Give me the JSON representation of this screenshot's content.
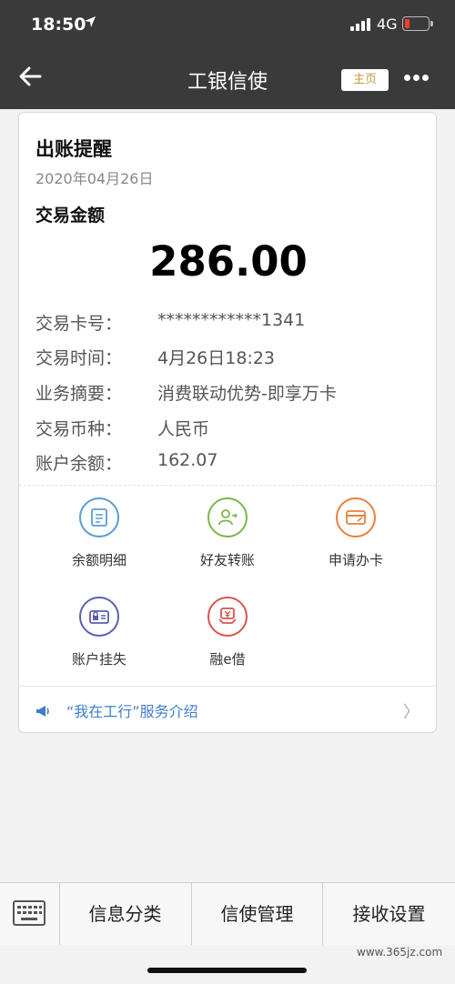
{
  "status_bar": {
    "time": "18:50",
    "network": "4G",
    "location_icon": "location-arrow-icon"
  },
  "nav": {
    "title": "工银信使",
    "home_button": "主页"
  },
  "card": {
    "heading": "出账提醒",
    "date": "2020年04月26日",
    "amount_label": "交易金额",
    "amount": "286.00",
    "rows": [
      {
        "key": "交易卡号：",
        "value": "************1341"
      },
      {
        "key": "交易时间：",
        "value": "4月26日18:23"
      },
      {
        "key": "业务摘要：",
        "value": "消费联动优势-即享万卡"
      },
      {
        "key": "交易币种：",
        "value": "人民币"
      },
      {
        "key": "账户余额：",
        "value": "162.07"
      }
    ],
    "actions": [
      {
        "label": "余额明细",
        "icon": "document-icon",
        "color": "#5b9bd5"
      },
      {
        "label": "好友转账",
        "icon": "person-transfer-icon",
        "color": "#7ab648"
      },
      {
        "label": "申请办卡",
        "icon": "card-icon",
        "color": "#e8803c"
      },
      {
        "label": "账户挂失",
        "icon": "lock-card-icon",
        "color": "#5a5fb0"
      },
      {
        "label": "融e借",
        "icon": "loan-icon",
        "color": "#d9534f"
      }
    ],
    "promo": "“我在工行”服务介绍"
  },
  "bottom_bar": {
    "keyboard_icon": "keyboard-icon",
    "tabs": [
      "信息分类",
      "信使管理",
      "接收设置"
    ]
  },
  "watermark": "www.365jz.com"
}
